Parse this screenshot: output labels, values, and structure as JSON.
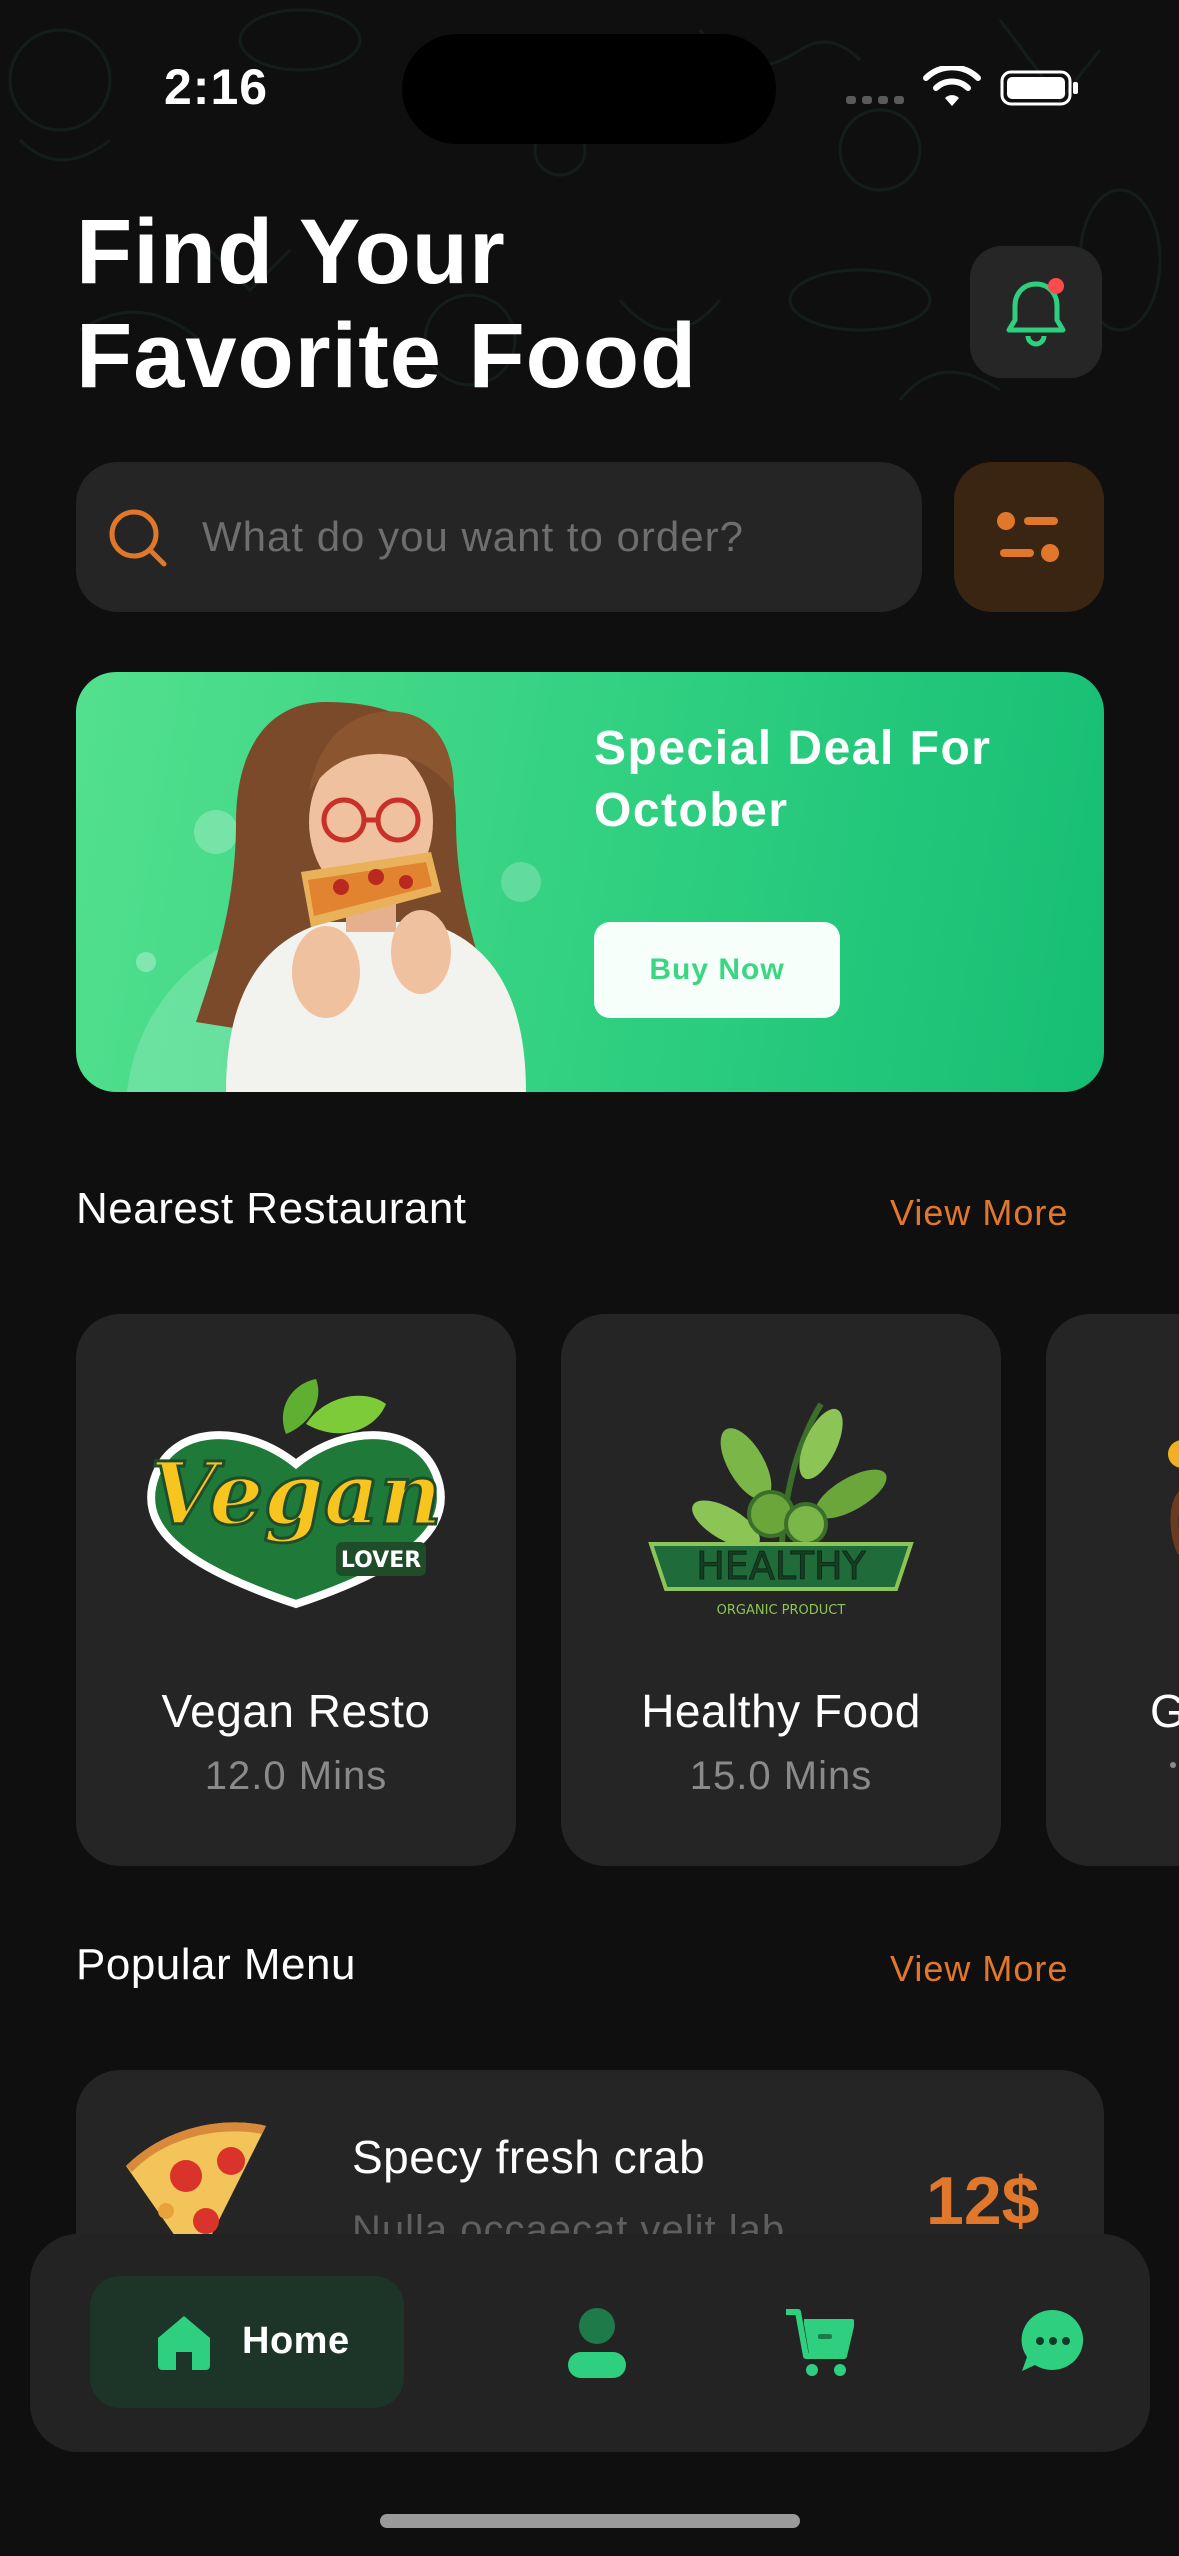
{
  "status_bar": {
    "time": "2:16"
  },
  "header": {
    "title_line1": "Find Your",
    "title_line2": "Favorite Food"
  },
  "search": {
    "placeholder": "What do you want to order?"
  },
  "banner": {
    "title": "Special Deal For October",
    "button_label": "Buy Now"
  },
  "nearest": {
    "title": "Nearest Restaurant",
    "view_more": "View More",
    "restaurants": [
      {
        "name": "Vegan Resto",
        "time": "12.0 Mins",
        "logo_text": "Vegan",
        "logo_sub": "LOVER"
      },
      {
        "name": "Healthy Food",
        "time": "15.0 Mins",
        "logo_text": "HEALTHY",
        "logo_sub": "ORGANIC PRODUCT"
      },
      {
        "name": "G",
        "time": ""
      }
    ]
  },
  "popular": {
    "title": "Popular Menu",
    "view_more": "View More",
    "items": [
      {
        "name": "Specy fresh crab",
        "description": "Nulla occaecat velit lab",
        "price": "12$"
      }
    ]
  },
  "nav": {
    "home_label": "Home",
    "accent": "#2fcf80"
  },
  "colors": {
    "accent_green": "#2fcf80",
    "accent_orange": "#e0772b",
    "card_bg": "#252525",
    "background": "#0f0f0f"
  }
}
